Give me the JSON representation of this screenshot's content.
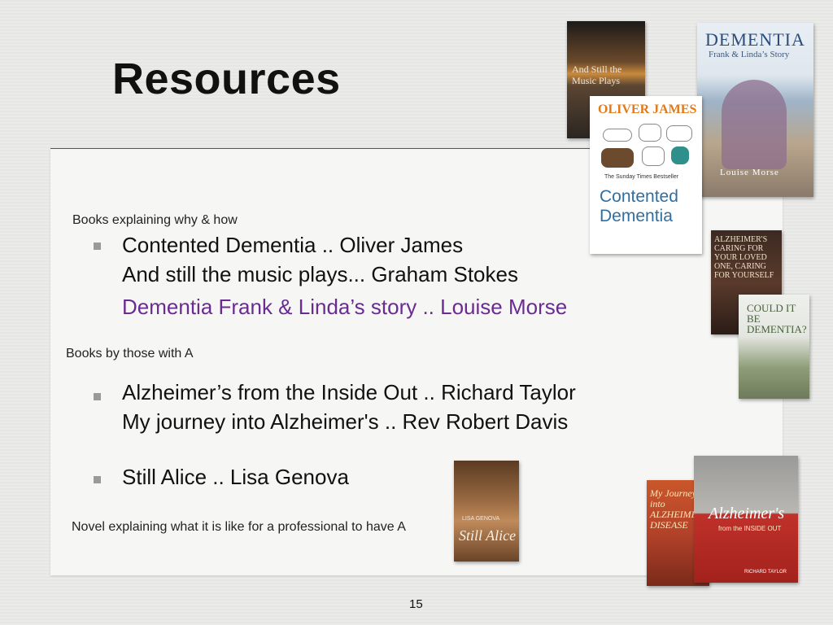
{
  "slide": {
    "title": "Resources",
    "page_number": "15"
  },
  "sections": {
    "why_how": {
      "label": "Books explaining why & how",
      "items": [
        "Contented Dementia .. Oliver James",
        "And still the music plays... Graham Stokes",
        "Dementia Frank & Linda’s story .. Louise Morse"
      ]
    },
    "by_those": {
      "label": "Books  by those with A",
      "items": [
        "Alzheimer’s from the Inside Out .. Richard Taylor",
        "My journey into Alzheimer's .. Rev Robert Davis"
      ]
    },
    "novel": {
      "item": "Still Alice .. Lisa Genova",
      "label": "Novel explaining what it is like for a professional to have A"
    }
  },
  "covers": {
    "music_plays": {
      "title": "And Still the Music Plays"
    },
    "dementia_frank_linda": {
      "title": "DEMENTIA",
      "subtitle": "Frank & Linda’s Story",
      "author": "Louise Morse"
    },
    "contented_dementia": {
      "author": "OLIVER JAMES",
      "title": "Contented Dementia",
      "tagline": "The Sunday Times Bestseller"
    },
    "alzheimers_caring": {
      "title": "ALZHEIMER'S CARING FOR YOUR LOVED ONE, CARING FOR YOURSELF"
    },
    "could_it_be": {
      "title": "COULD IT BE DEMENTIA?"
    },
    "still_alice": {
      "author": "LISA GENOVA",
      "title": "Still Alice"
    },
    "my_journey": {
      "title": "My Journey into ALZHEIMER'S DISEASE"
    },
    "inside_out": {
      "title": "Alzheimer's",
      "subtitle": "from the INSIDE OUT",
      "author": "RICHARD TAYLOR"
    }
  },
  "colors": {
    "purple_text": "#6a2c91",
    "bullet": "#9a9a9a"
  }
}
